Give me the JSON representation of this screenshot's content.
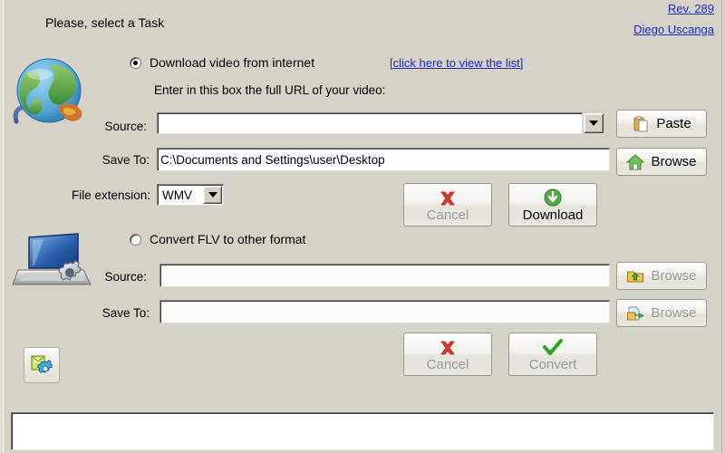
{
  "window": {
    "background_color": "#d6d2c8"
  },
  "header": {
    "prompt": "Please, select a Task",
    "revision_link": "Rev. 289",
    "author_link": "Diego Uscanga",
    "link_color": "#1d2fc4"
  },
  "download_section": {
    "radio_label": "Download video from internet",
    "radio_selected": true,
    "list_link": "[click here to view the list]",
    "hint": "Enter in this box the full URL of your video:",
    "source_label": "Source:",
    "source_value": "",
    "source_placeholder": "",
    "save_to_label": "Save To:",
    "save_to_value": "C:\\Documents and Settings\\user\\Desktop",
    "file_extension_label": "File extension:",
    "file_extension_value": "WMV",
    "file_extension_options": [
      "WMV"
    ],
    "paste_button": "Paste",
    "browse_button": "Browse",
    "cancel_button": "Cancel",
    "download_button": "Download",
    "cancel_enabled": false,
    "download_enabled": true
  },
  "convert_section": {
    "radio_label": "Convert FLV to other format",
    "radio_selected": false,
    "source_label": "Source:",
    "source_value": "",
    "save_to_label": "Save To:",
    "save_to_value": "",
    "browse_source_button": "Browse",
    "browse_saveto_button": "Browse",
    "cancel_button": "Cancel",
    "convert_button": "Convert",
    "enabled": false
  },
  "footer": {
    "log_value": ""
  },
  "icons": {
    "globe": "globe-internet-icon",
    "laptop": "laptop-gear-icon",
    "settings": "settings-icon",
    "paste": "clipboard-icon",
    "browse_home": "green-home-icon",
    "browse_folder_up": "folder-up-arrow-icon",
    "browse_file_out": "file-export-icon",
    "cancel": "red-x-icon",
    "download": "green-download-arrow-icon",
    "convert": "green-check-icon",
    "dropdown": "chevron-down-icon"
  }
}
